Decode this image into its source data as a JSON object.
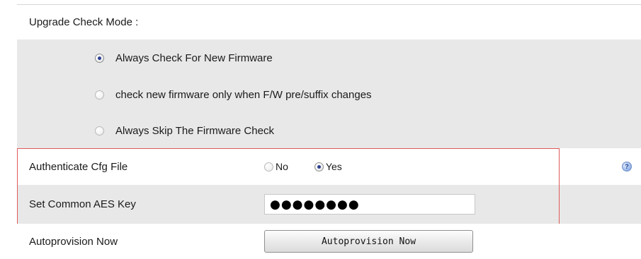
{
  "upgrade_check_mode": {
    "title": "Upgrade Check Mode :",
    "options": [
      {
        "label": "Always Check For New Firmware",
        "selected": true
      },
      {
        "label": "check new firmware only when F/W pre/suffix changes",
        "selected": false
      },
      {
        "label": "Always Skip The Firmware Check",
        "selected": false
      }
    ]
  },
  "authenticate_cfg_file": {
    "label": "Authenticate Cfg File",
    "options": [
      {
        "label": "No",
        "selected": false
      },
      {
        "label": "Yes",
        "selected": true
      }
    ],
    "help_icon": "help-question-icon"
  },
  "common_aes_key": {
    "label": "Set Common AES Key",
    "masked_value": "●●●●●●●●"
  },
  "autoprovision": {
    "label": "Autoprovision Now",
    "button_label": "Autoprovision Now"
  },
  "colors": {
    "row_gray": "#e8e8e8",
    "highlight_frame": "#e05a5a",
    "radio_selected": "#2a3f8f"
  }
}
